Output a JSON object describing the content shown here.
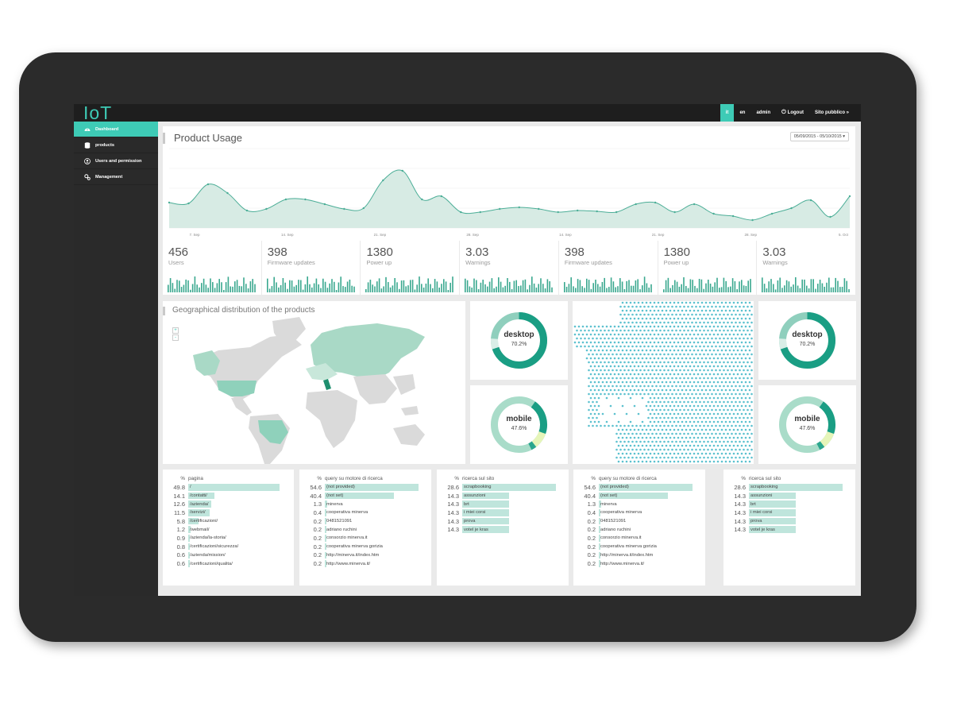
{
  "app": {
    "logo": "IoT"
  },
  "topnav": {
    "items": [
      "it",
      "en",
      "admin",
      "Logout",
      "Sito pubblico »"
    ]
  },
  "sidebar": {
    "items": [
      "Dashboard",
      "products",
      "Users and permission",
      "Management"
    ]
  },
  "usage": {
    "title": "Product Usage",
    "date_range": "05/09/2015 - 05/10/2015"
  },
  "chart_data": {
    "type": "area",
    "x_tick_labels": [
      "7. Sep",
      "14. Sep",
      "21. Sep",
      "28. Sep",
      "14. Sep",
      "21. Sep",
      "28. Sep",
      "5. Oct"
    ],
    "values": [
      32,
      31,
      55,
      44,
      22,
      24,
      36,
      36,
      30,
      24,
      25,
      60,
      72,
      36,
      40,
      20,
      20,
      24,
      26,
      24,
      20,
      22,
      21,
      20,
      30,
      32,
      20,
      30,
      18,
      15,
      10,
      18,
      25,
      35,
      14,
      40
    ],
    "colors": {
      "line": "#4cae97",
      "fill": "#d7ebe4"
    }
  },
  "stats": [
    {
      "value": "456",
      "label": "Users"
    },
    {
      "value": "398",
      "label": "Firmware updates"
    },
    {
      "value": "1380",
      "label": "Power up"
    },
    {
      "value": "3.03",
      "label": "Warnings"
    },
    {
      "value": "398",
      "label": "Firmware updates"
    },
    {
      "value": "1380",
      "label": "Power up"
    },
    {
      "value": "3.03",
      "label": "Warnings"
    }
  ],
  "geo": {
    "title": "Geographical distribution of the products",
    "zoom_in": "+",
    "zoom_out": "-"
  },
  "donuts": [
    {
      "label": "desktop",
      "pct": "70.2%"
    },
    {
      "label": "mobile",
      "pct": "47.6%"
    },
    {
      "label": "desktop",
      "pct": "70.2%"
    },
    {
      "label": "mobile",
      "pct": "47.6%"
    }
  ],
  "tables": [
    {
      "h_pct": "%",
      "h_label": "pagina",
      "rows": [
        {
          "pct": "49.8",
          "label": "/"
        },
        {
          "pct": "14.1",
          "label": "/contatti/"
        },
        {
          "pct": "12.6",
          "label": "/azienda/"
        },
        {
          "pct": "11.5",
          "label": "/servizi/"
        },
        {
          "pct": "5.8",
          "label": "/certificazioni/"
        },
        {
          "pct": "1.2",
          "label": "/webmail/"
        },
        {
          "pct": "0.9",
          "label": "/azienda/la-storia/"
        },
        {
          "pct": "0.8",
          "label": "/certificazioni/sicurezza/"
        },
        {
          "pct": "0.6",
          "label": "/azienda/mission/"
        },
        {
          "pct": "0.6",
          "label": "/certificazioni/qualita/"
        }
      ]
    },
    {
      "h_pct": "%",
      "h_label": "query su motore di ricerca",
      "rows": [
        {
          "pct": "54.6",
          "label": "(not provided)"
        },
        {
          "pct": "40.4",
          "label": "(not set)"
        },
        {
          "pct": "1.3",
          "label": "minerva"
        },
        {
          "pct": "0.4",
          "label": "cooperativa minerva"
        },
        {
          "pct": "0.2",
          "label": "0481521091"
        },
        {
          "pct": "0.2",
          "label": "adriano ruchini"
        },
        {
          "pct": "0.2",
          "label": "consorzio minerva.it"
        },
        {
          "pct": "0.2",
          "label": "cooperativa minerva gorizia"
        },
        {
          "pct": "0.2",
          "label": "http://minerva.it/index.htm"
        },
        {
          "pct": "0.2",
          "label": "http://www.minerva.it/"
        }
      ]
    },
    {
      "h_pct": "%",
      "h_label": "ricerca sul sito",
      "rows": [
        {
          "pct": "28.6",
          "label": "scrapbooking"
        },
        {
          "pct": "14.3",
          "label": "assunzioni"
        },
        {
          "pct": "14.3",
          "label": "brt"
        },
        {
          "pct": "14.3",
          "label": "i miei corsi"
        },
        {
          "pct": "14.3",
          "label": "prova"
        },
        {
          "pct": "14.3",
          "label": "votel je kras"
        }
      ]
    },
    {
      "h_pct": "%",
      "h_label": "query su motore di ricerca",
      "rows": [
        {
          "pct": "54.6",
          "label": "(not provided)"
        },
        {
          "pct": "40.4",
          "label": "(not set)"
        },
        {
          "pct": "1.3",
          "label": "minerva"
        },
        {
          "pct": "0.4",
          "label": "cooperativa minerva"
        },
        {
          "pct": "0.2",
          "label": "0481521091"
        },
        {
          "pct": "0.2",
          "label": "adriano ruchini"
        },
        {
          "pct": "0.2",
          "label": "consorzio minerva.it"
        },
        {
          "pct": "0.2",
          "label": "cooperativa minerva gorizia"
        },
        {
          "pct": "0.2",
          "label": "http://minerva.it/index.htm"
        },
        {
          "pct": "0.2",
          "label": "http://www.minerva.it/"
        }
      ]
    },
    {
      "h_pct": "%",
      "h_label": "ricerca sul sito",
      "rows": [
        {
          "pct": "28.6",
          "label": "scrapbooking"
        },
        {
          "pct": "14.3",
          "label": "assunzioni"
        },
        {
          "pct": "14.3",
          "label": "brt"
        },
        {
          "pct": "14.3",
          "label": "i miei corsi"
        },
        {
          "pct": "14.3",
          "label": "prova"
        },
        {
          "pct": "14.3",
          "label": "votel je kras"
        }
      ]
    }
  ]
}
